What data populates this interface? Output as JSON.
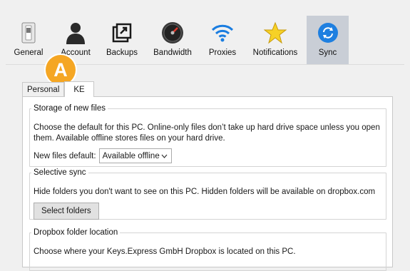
{
  "toolbar": {
    "items": [
      {
        "label": "General",
        "icon": "toggle-switch-icon"
      },
      {
        "label": "Account",
        "icon": "user-silhouette-icon"
      },
      {
        "label": "Backups",
        "icon": "backup-icon"
      },
      {
        "label": "Bandwidth",
        "icon": "speedometer-icon"
      },
      {
        "label": "Proxies",
        "icon": "wifi-icon"
      },
      {
        "label": "Notifications",
        "icon": "star-icon"
      },
      {
        "label": "Sync",
        "icon": "sync-icon",
        "active": true
      }
    ]
  },
  "badge": {
    "label": "A",
    "color": "#f5a623"
  },
  "tabs": [
    {
      "label": "Personal"
    },
    {
      "label": "KE",
      "selected": true
    }
  ],
  "storage": {
    "title": "Storage of new files",
    "line1": "Choose the default for this PC. Online-only files don’t take up hard drive space unless you open",
    "line2": "them. Available offline stores files on your hard drive.",
    "default_label": "New files default:",
    "default_value": "Available offline"
  },
  "selective": {
    "title": "Selective sync",
    "desc": "Hide folders you don't want to see on this PC. Hidden folders will be available on dropbox.com",
    "button": "Select folders"
  },
  "location": {
    "title": "Dropbox folder location",
    "desc": "Choose where your Keys.Express GmbH Dropbox is located on this PC."
  }
}
